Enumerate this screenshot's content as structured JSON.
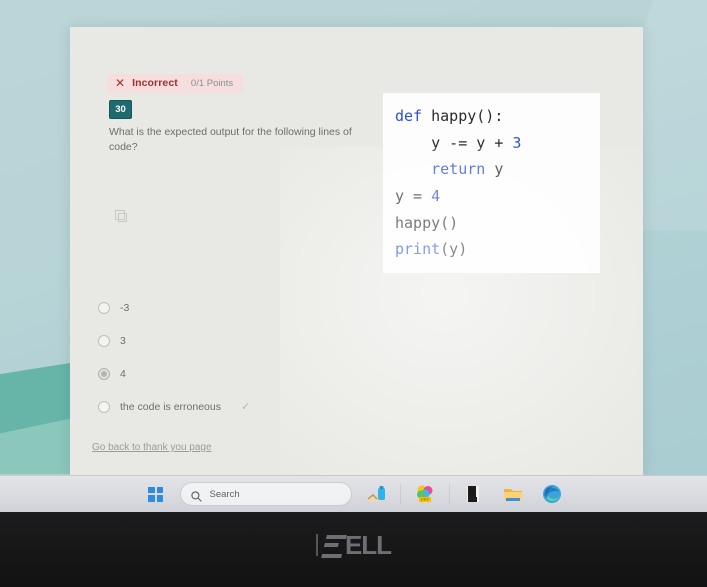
{
  "quiz": {
    "result_icon": "✕",
    "result_label": "Incorrect",
    "points": "0/1 Points",
    "question_number": "30",
    "question_text": "What is the expected output for the following lines of code?",
    "image_icon": "image-placeholder-icon",
    "back_link": "Go back to thank you page",
    "options": [
      {
        "label": "-3",
        "selected": false,
        "correct": false
      },
      {
        "label": "3",
        "selected": false,
        "correct": false
      },
      {
        "label": "4",
        "selected": true,
        "correct": false
      },
      {
        "label": "the code is erroneous",
        "selected": false,
        "correct": true,
        "check": "✓"
      }
    ],
    "code": {
      "language": "python",
      "lines": [
        {
          "tokens": [
            {
              "t": "def ",
              "c": "kw"
            },
            {
              "t": "happy():",
              "c": ""
            }
          ]
        },
        {
          "tokens": [
            {
              "t": "    y -= y + ",
              "c": ""
            },
            {
              "t": "3",
              "c": "num"
            }
          ]
        },
        {
          "tokens": [
            {
              "t": "    ",
              "c": ""
            },
            {
              "t": "return",
              "c": "kw"
            },
            {
              "t": " y",
              "c": ""
            }
          ]
        },
        {
          "tokens": [
            {
              "t": "y = ",
              "c": ""
            },
            {
              "t": "4",
              "c": "num"
            }
          ]
        },
        {
          "tokens": [
            {
              "t": "happy()",
              "c": ""
            }
          ]
        },
        {
          "tokens": [
            {
              "t": "print",
              "c": "fn"
            },
            {
              "t": "(y)",
              "c": ""
            }
          ]
        }
      ]
    },
    "colors": {
      "incorrect_bg": "#f7dede",
      "incorrect_text": "#9c2f2f",
      "badge_bg": "#1f6a6e",
      "keyword": "#2d4fd6"
    }
  },
  "taskbar": {
    "start_label": "Start",
    "search_placeholder": "Search",
    "apps": [
      {
        "name": "snipping-tool-icon"
      },
      {
        "name": "photos-icon"
      },
      {
        "name": "dark-app-icon"
      },
      {
        "name": "file-explorer-icon"
      },
      {
        "name": "microsoft-edge-icon"
      }
    ]
  },
  "monitor": {
    "brand": "ELL"
  }
}
